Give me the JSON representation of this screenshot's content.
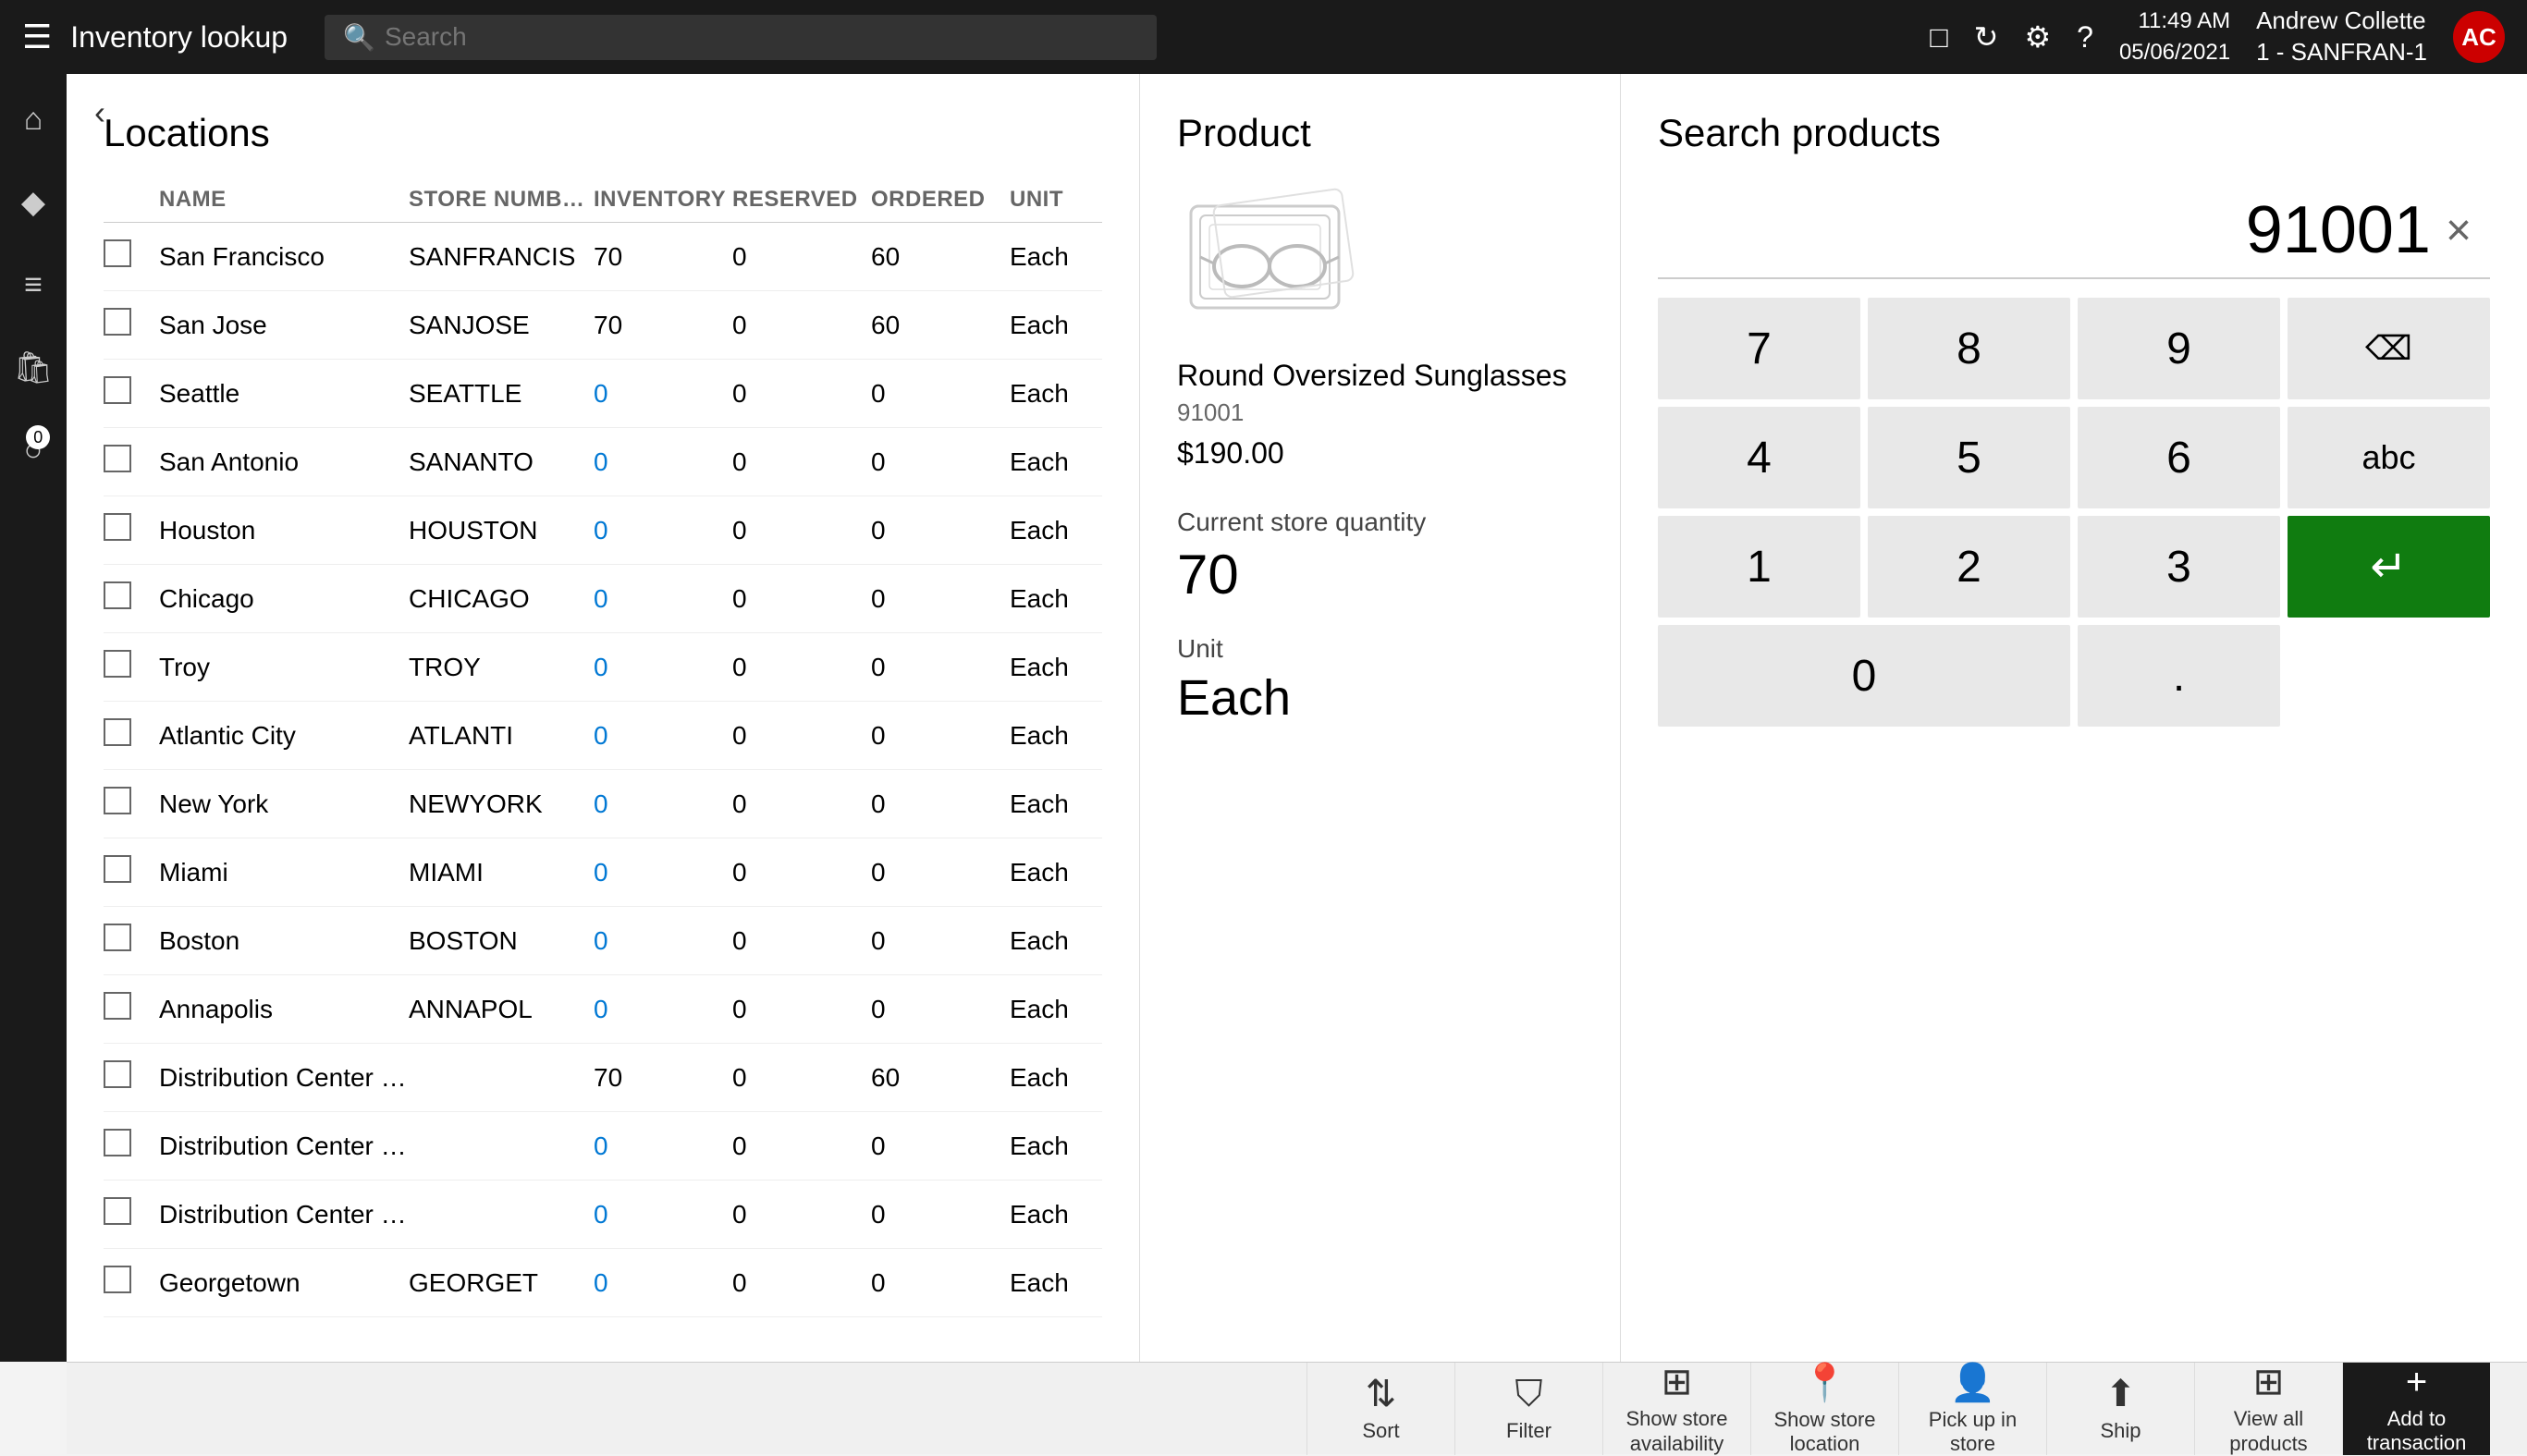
{
  "topbar": {
    "hamburger": "☰",
    "title": "Inventory lookup",
    "search_placeholder": "Search",
    "time": "11:49 AM",
    "date": "05/06/2021",
    "user_name": "Andrew Collette",
    "user_store": "1 - SANFRAN-1",
    "avatar_initials": "AC"
  },
  "sidebar": {
    "icons": [
      "⌂",
      "♦",
      "☰",
      "🛍",
      "0"
    ]
  },
  "locations": {
    "title": "Locations",
    "columns": {
      "name": "NAME",
      "store_number": "STORE NUMBER",
      "inventory": "INVENTORY",
      "reserved": "RESERVED",
      "ordered": "ORDERED",
      "unit": "UNIT"
    },
    "rows": [
      {
        "name": "San Francisco",
        "store": "SANFRANCIS",
        "inventory": "70",
        "reserved": "0",
        "ordered": "60",
        "unit": "Each",
        "inv_zero": false
      },
      {
        "name": "San Jose",
        "store": "SANJOSE",
        "inventory": "70",
        "reserved": "0",
        "ordered": "60",
        "unit": "Each",
        "inv_zero": false
      },
      {
        "name": "Seattle",
        "store": "SEATTLE",
        "inventory": "0",
        "reserved": "0",
        "ordered": "0",
        "unit": "Each",
        "inv_zero": true
      },
      {
        "name": "San Antonio",
        "store": "SANANTO",
        "inventory": "0",
        "reserved": "0",
        "ordered": "0",
        "unit": "Each",
        "inv_zero": true
      },
      {
        "name": "Houston",
        "store": "HOUSTON",
        "inventory": "0",
        "reserved": "0",
        "ordered": "0",
        "unit": "Each",
        "inv_zero": true
      },
      {
        "name": "Chicago",
        "store": "CHICAGO",
        "inventory": "0",
        "reserved": "0",
        "ordered": "0",
        "unit": "Each",
        "inv_zero": true
      },
      {
        "name": "Troy",
        "store": "TROY",
        "inventory": "0",
        "reserved": "0",
        "ordered": "0",
        "unit": "Each",
        "inv_zero": true
      },
      {
        "name": "Atlantic City",
        "store": "ATLANTI",
        "inventory": "0",
        "reserved": "0",
        "ordered": "0",
        "unit": "Each",
        "inv_zero": true
      },
      {
        "name": "New York",
        "store": "NEWYORK",
        "inventory": "0",
        "reserved": "0",
        "ordered": "0",
        "unit": "Each",
        "inv_zero": true
      },
      {
        "name": "Miami",
        "store": "MIAMI",
        "inventory": "0",
        "reserved": "0",
        "ordered": "0",
        "unit": "Each",
        "inv_zero": true
      },
      {
        "name": "Boston",
        "store": "BOSTON",
        "inventory": "0",
        "reserved": "0",
        "ordered": "0",
        "unit": "Each",
        "inv_zero": true
      },
      {
        "name": "Annapolis",
        "store": "ANNAPOL",
        "inventory": "0",
        "reserved": "0",
        "ordered": "0",
        "unit": "Each",
        "inv_zero": true
      },
      {
        "name": "Distribution Center - Central Regi...",
        "store": "",
        "inventory": "70",
        "reserved": "0",
        "ordered": "60",
        "unit": "Each",
        "inv_zero": false
      },
      {
        "name": "Distribution Center - East Region",
        "store": "",
        "inventory": "0",
        "reserved": "0",
        "ordered": "0",
        "unit": "Each",
        "inv_zero": true
      },
      {
        "name": "Distribution Center - West Region",
        "store": "",
        "inventory": "0",
        "reserved": "0",
        "ordered": "0",
        "unit": "Each",
        "inv_zero": true
      },
      {
        "name": "Georgetown",
        "store": "GEORGET",
        "inventory": "0",
        "reserved": "0",
        "ordered": "0",
        "unit": "Each",
        "inv_zero": true
      }
    ]
  },
  "product": {
    "title": "Product",
    "name": "Round Oversized Sunglasses",
    "id": "91001",
    "price": "$190.00",
    "current_qty_label": "Current store quantity",
    "current_qty": "70",
    "unit_label": "Unit",
    "unit": "Each"
  },
  "search_products": {
    "title": "Search products",
    "display_value": "91001"
  },
  "numpad": {
    "keys": [
      "7",
      "8",
      "9",
      "⌫",
      "4",
      "5",
      "6",
      "abc",
      "1",
      "2",
      "3",
      "↵",
      "0",
      "."
    ]
  },
  "toolbar": {
    "sort": "Sort",
    "filter": "Filter",
    "show_store_availability": "Show store\navailability",
    "show_store_location": "Show store\nlocation",
    "pick_up_in_store": "Pick up in\nstore",
    "ship": "Ship",
    "view_all_products": "View all\nproducts",
    "add_to_transaction": "Add to\ntransaction"
  }
}
